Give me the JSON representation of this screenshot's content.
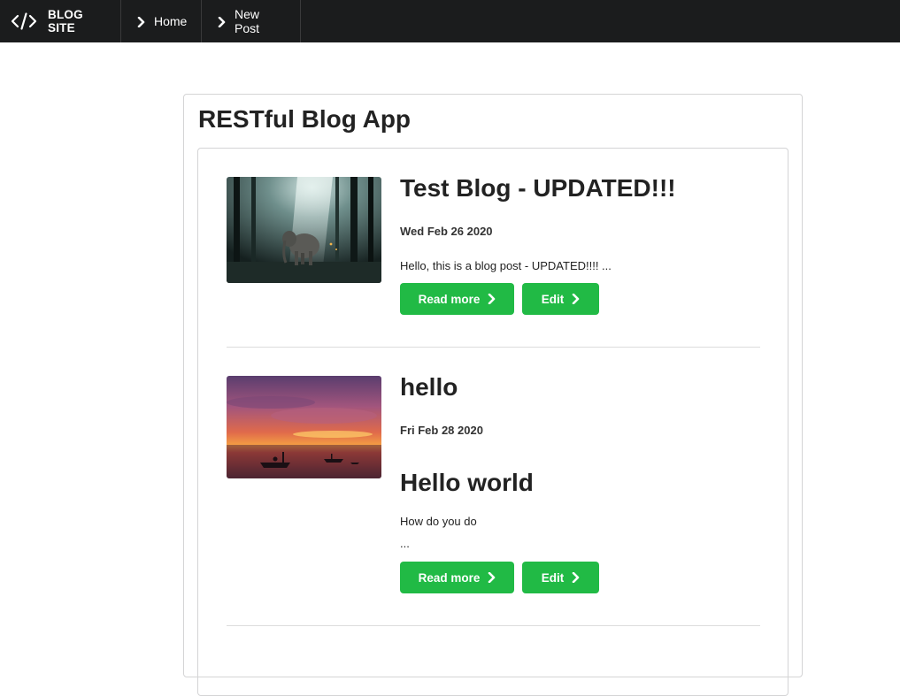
{
  "navbar": {
    "brand_label": "BLOG SITE",
    "brand_icon": "code-icon",
    "home_label": "Home",
    "new_post_label": "New Post",
    "background_color": "#1b1c1d"
  },
  "main": {
    "title": "RESTful Blog App"
  },
  "posts": [
    {
      "title": "Test Blog - UPDATED!!!",
      "date": "Wed Feb 26 2020",
      "excerpt": "Hello, this is a blog post - UPDATED!!!! ...",
      "image": "elephant-in-forest",
      "read_more_label": "Read more",
      "edit_label": "Edit"
    },
    {
      "title": "hello",
      "date": "Fri Feb 28 2020",
      "body_heading": "Hello world",
      "excerpt": "How do you do",
      "ellipsis": "...",
      "image": "sunset-boats",
      "read_more_label": "Read more",
      "edit_label": "Edit"
    }
  ],
  "colors": {
    "button_green": "#21ba45",
    "text_dark": "#222222",
    "border": "#d4d4d5"
  }
}
